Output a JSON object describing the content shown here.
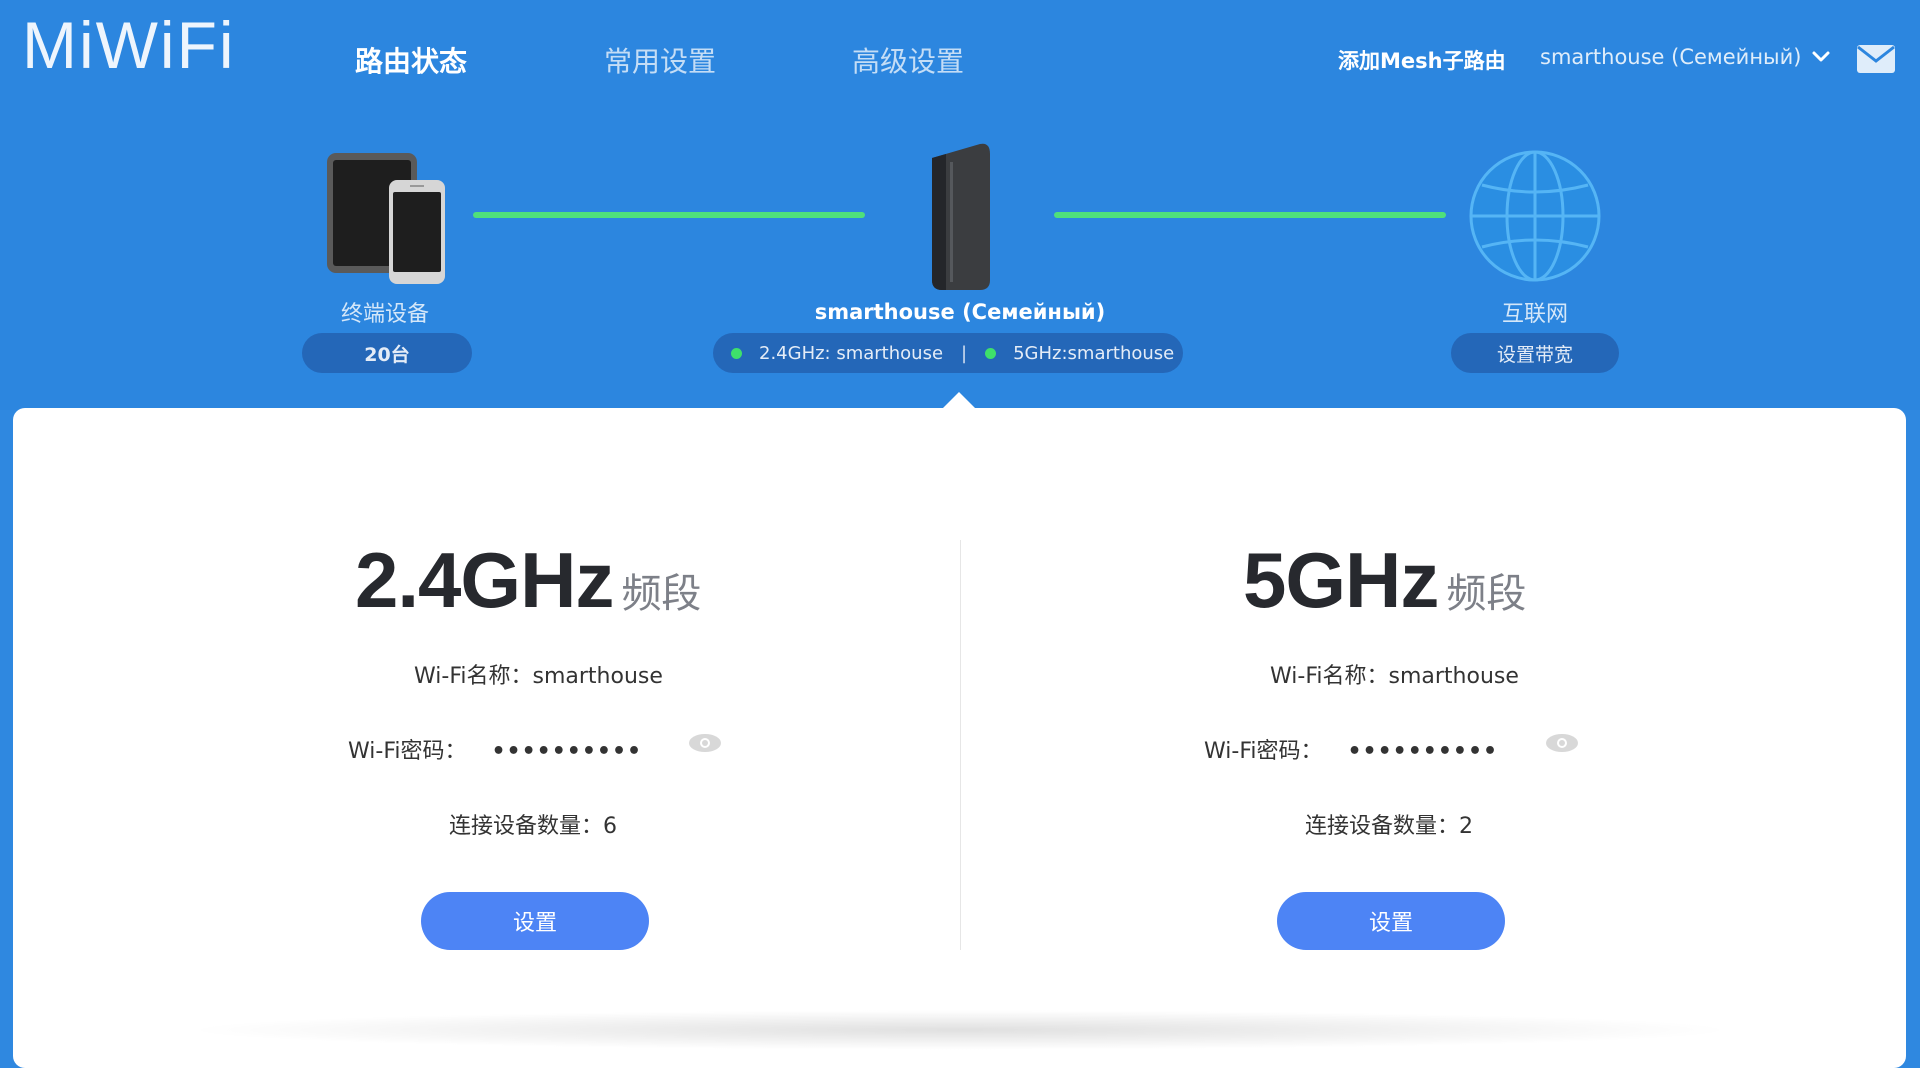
{
  "logo": {
    "text": "MiWiFi"
  },
  "nav": [
    {
      "label": "路由状态",
      "active": true
    },
    {
      "label": "常用设置",
      "active": false
    },
    {
      "label": "高级设置",
      "active": false
    }
  ],
  "header": {
    "mesh_link": "添加Mesh子路由",
    "user": "smarthouse (Семейный)",
    "user_dropdown_icon": "chevron-down-icon",
    "mail_icon": "mail-icon"
  },
  "topology": {
    "devices": {
      "label": "终端设备",
      "count": "20台",
      "icon": "tablet-phone-icon"
    },
    "router": {
      "name": "smarthouse (Семейный)",
      "band_24": "2.4GHz: smarthouse",
      "separator": "|",
      "band_5": "5GHz:smarthouse",
      "icon": "router-icon"
    },
    "internet": {
      "label": "互联网",
      "action": "设置带宽",
      "icon": "globe-icon"
    },
    "link_color": "#4fe07b"
  },
  "bands": [
    {
      "title": "2.4GHz",
      "suffix": "频段",
      "wifi_name_label": "Wi-Fi名称：",
      "wifi_name": "smarthouse",
      "wifi_password_label": "Wi-Fi密码：",
      "wifi_password": "••••••••••",
      "devices_label": "连接设备数量：",
      "devices_count": "6",
      "button": "设置"
    },
    {
      "title": "5GHz",
      "suffix": "频段",
      "wifi_name_label": "Wi-Fi名称：",
      "wifi_name": "smarthouse",
      "wifi_password_label": "Wi-Fi密码：",
      "wifi_password": "••••••••••",
      "devices_label": "连接设备数量：",
      "devices_count": "2",
      "button": "设置"
    }
  ],
  "colors": {
    "header_bg": "#2c86df",
    "pill_bg": "#2467b8",
    "button_bg": "#4d84f5",
    "status_dot": "#3ee06b"
  }
}
